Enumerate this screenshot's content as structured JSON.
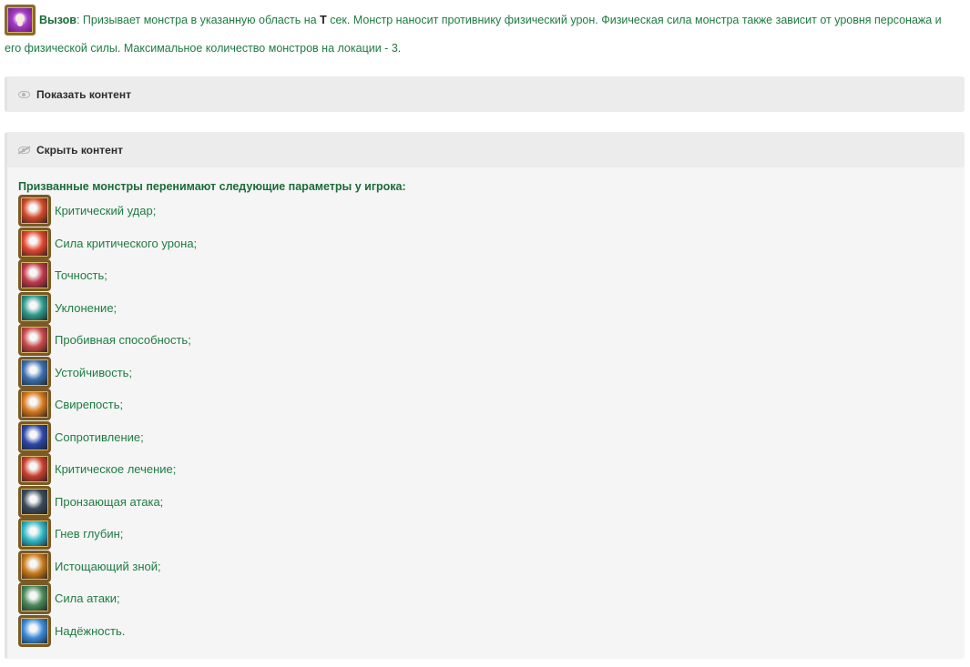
{
  "intro": {
    "skill_name": "Вызов",
    "text_a": ": Призывает монстра в указанную область на ",
    "t_symbol": "T",
    "text_b": " сек. Монстр наносит противнику физический урон. Физическая сила монстра также зависит от уровня персонажа и",
    "line2": "его физической силы. Максимальное количество монстров на локации - 3."
  },
  "spoilers": {
    "show_label": "Показать контент",
    "hide_label": "Скрыть контент"
  },
  "list": {
    "heading": "Призванные монстры перенимают следующие параметры у игрока:",
    "items": [
      {
        "label": "Критический удар;",
        "icon": "critical-strike-icon",
        "color": "#d24a2a"
      },
      {
        "label": "Сила критического урона;",
        "icon": "critical-damage-icon",
        "color": "#e2462e"
      },
      {
        "label": "Точность;",
        "icon": "accuracy-icon",
        "color": "#c23a4a"
      },
      {
        "label": "Уклонение;",
        "icon": "evasion-icon",
        "color": "#2f9a8e"
      },
      {
        "label": "Пробивная способность;",
        "icon": "penetration-icon",
        "color": "#c94a4a"
      },
      {
        "label": "Устойчивость;",
        "icon": "resilience-icon",
        "color": "#3c6fb0"
      },
      {
        "label": "Свирепость;",
        "icon": "ferocity-icon",
        "color": "#d87a1e"
      },
      {
        "label": "Сопротивление;",
        "icon": "resistance-icon",
        "color": "#2b47a8"
      },
      {
        "label": "Критическое лечение;",
        "icon": "critical-heal-icon",
        "color": "#c9402e"
      },
      {
        "label": "Пронзающая атака;",
        "icon": "piercing-attack-icon",
        "color": "#3a4a5a"
      },
      {
        "label": "Гнев глубин;",
        "icon": "wrath-of-depths-icon",
        "color": "#2fb8c8"
      },
      {
        "label": "Истощающий зной;",
        "icon": "scorching-heat-icon",
        "color": "#c87a1a"
      },
      {
        "label": "Сила атаки;",
        "icon": "attack-power-icon",
        "color": "#4a8a5a"
      },
      {
        "label": "Надёжность.",
        "icon": "reliability-icon",
        "color": "#3a8ad8"
      }
    ]
  }
}
